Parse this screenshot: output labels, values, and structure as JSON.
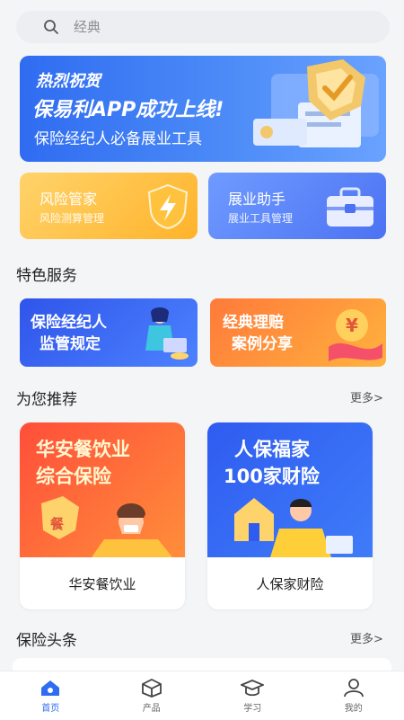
{
  "search": {
    "placeholder": "经典",
    "icon": "search-icon"
  },
  "banner": {
    "line1": "热烈祝贺",
    "line2": "保易利APP成功上线!",
    "line3": "保险经纪人必备展业工具"
  },
  "entries": [
    {
      "title": "风险管家",
      "subtitle": "风险测算管理",
      "icon": "lightning-shield-icon"
    },
    {
      "title": "展业助手",
      "subtitle": "展业工具管理",
      "icon": "briefcase-icon"
    }
  ],
  "featured": {
    "heading": "特色服务",
    "items": [
      {
        "line1": "保险经纪人",
        "line2": "监管规定"
      },
      {
        "line1": "经典理赔",
        "line2": "案例分享"
      }
    ]
  },
  "recommend": {
    "heading": "为您推荐",
    "more": "更多>",
    "items": [
      {
        "line1": "华安餐饮业",
        "line2": "综合保险",
        "badge": "餐",
        "caption": "华安餐饮业"
      },
      {
        "line1": "人保福家",
        "line2": "100家财险",
        "caption": "人保家财险"
      }
    ]
  },
  "news": {
    "heading": "保险头条",
    "more": "更多>"
  },
  "nav": [
    {
      "label": "首页",
      "icon": "home-icon",
      "active": true
    },
    {
      "label": "产品",
      "icon": "box-icon",
      "active": false
    },
    {
      "label": "学习",
      "icon": "graduation-cap-icon",
      "active": false
    },
    {
      "label": "我的",
      "icon": "user-icon",
      "active": false
    }
  ],
  "colors": {
    "accent": "#2f6cf1",
    "background": "#f4f5f7"
  }
}
